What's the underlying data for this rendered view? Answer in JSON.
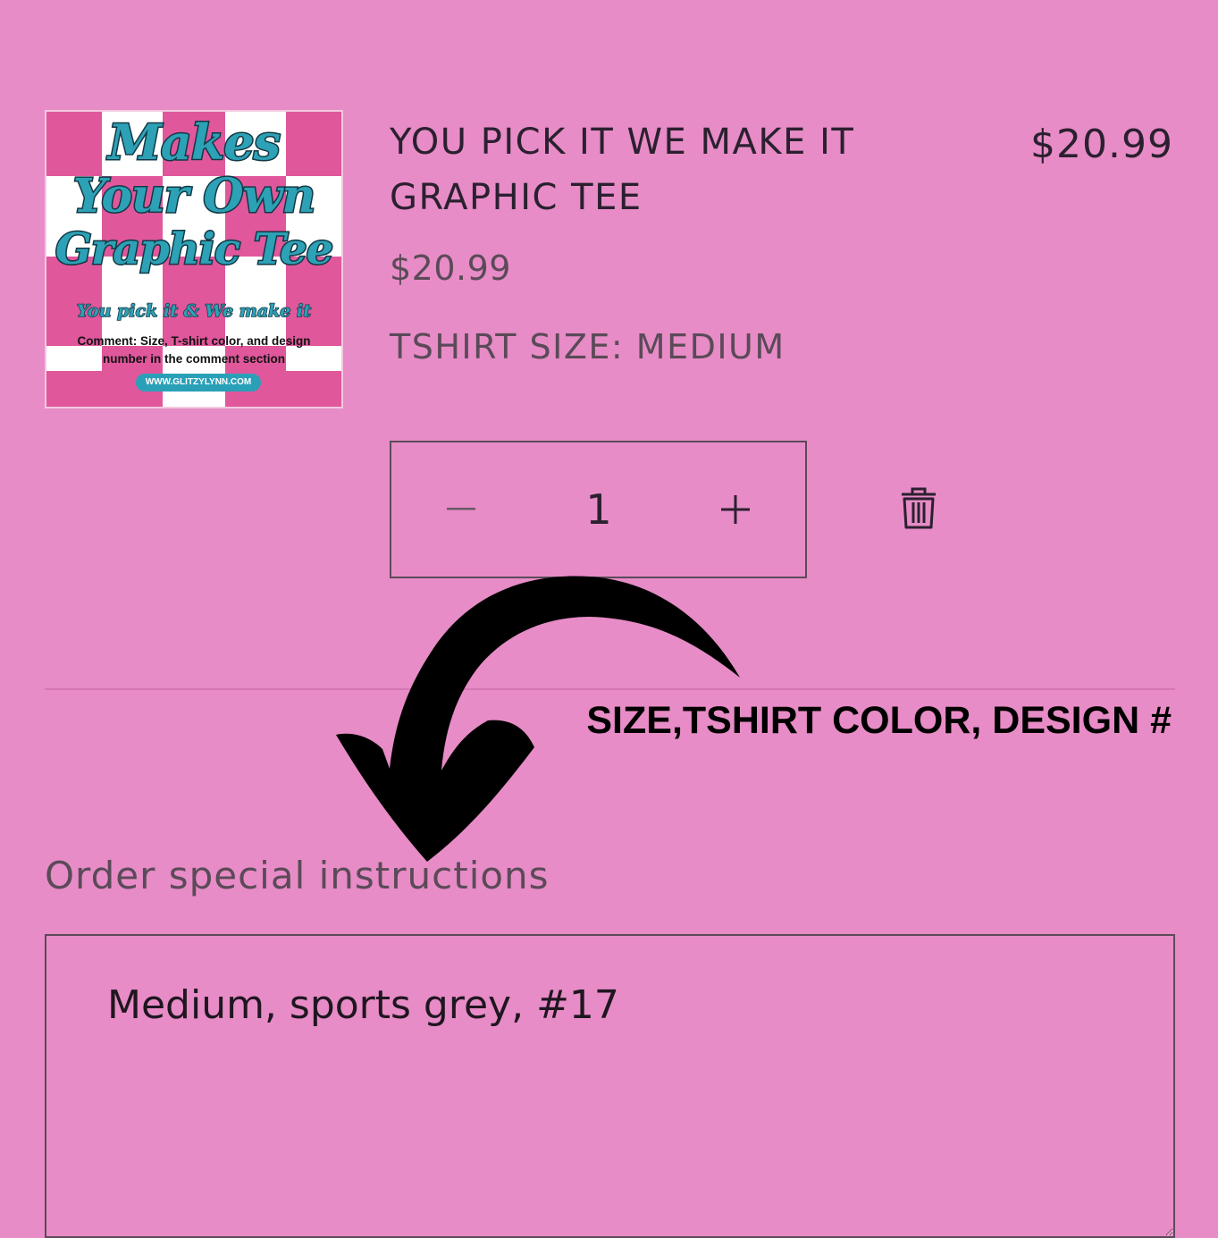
{
  "thumbnail": {
    "title_lines": [
      "Makes",
      "Your Own",
      "Graphic Tee"
    ],
    "tagline": "You pick it & We make it",
    "note": "Comment: Size, T-shirt color, and design number in the comment section",
    "url": "WWW.GLITZYLYNN.COM",
    "colors": {
      "pink": "#e0579c",
      "white": "#ffffff",
      "teal": "#2da1b6"
    }
  },
  "product": {
    "title": "YOU PICK IT WE MAKE IT GRAPHIC TEE",
    "line_price": "$20.99",
    "unit_price": "$20.99",
    "variant": "TSHIRT SIZE: MEDIUM"
  },
  "quantity": {
    "value": "1",
    "decrease_icon": "minus-icon",
    "increase_icon": "plus-icon"
  },
  "remove_icon": "trash-icon",
  "callout": "SIZE,TSHIRT COLOR, DESIGN #",
  "instructions": {
    "label": "Order special instructions",
    "value": "Medium, sports grey, #17"
  },
  "colors": {
    "background": "#e78cc6",
    "text": "#2b2030",
    "border": "#5d4a5a",
    "arrow": "#000000"
  }
}
